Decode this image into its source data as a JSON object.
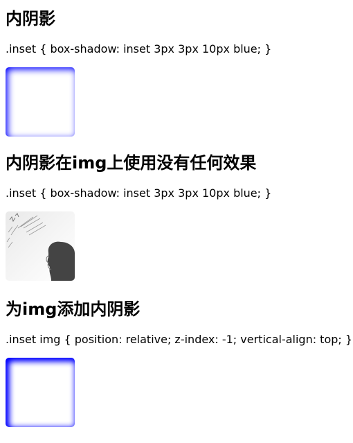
{
  "sections": [
    {
      "title": "内阴影",
      "code": ".inset { box-shadow: inset 3px 3px 10px blue; }"
    },
    {
      "title": "内阴影在img上使用没有任何效果",
      "code": ".inset { box-shadow: inset 3px 3px 10px blue; }"
    },
    {
      "title": "为img添加内阴影",
      "code": ".inset img { position: relative; z-index: -1; vertical-align: top; }"
    }
  ],
  "colors": {
    "shadow": "#0000ff",
    "text": "#000000",
    "background": "#ffffff",
    "silhouette": "#444444"
  }
}
